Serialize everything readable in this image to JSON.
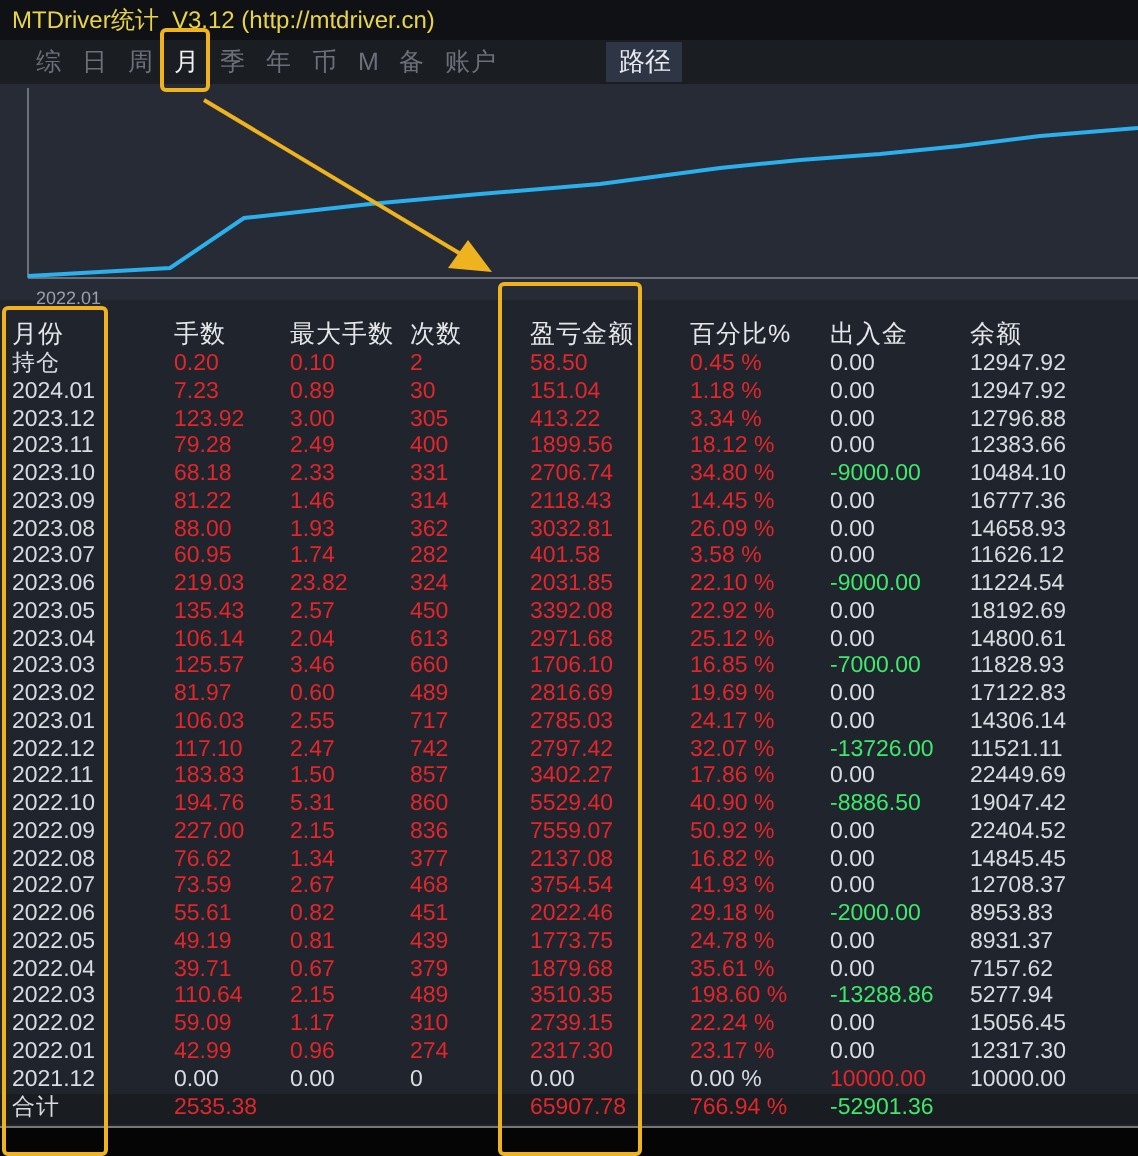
{
  "window": {
    "title": "MTDriver统计  V3.12 (http://mtdriver.cn)"
  },
  "tabs": [
    {
      "label": "综",
      "selected": false
    },
    {
      "label": "日",
      "selected": false
    },
    {
      "label": "周",
      "selected": false
    },
    {
      "label": "月",
      "selected": true
    },
    {
      "label": "季",
      "selected": false
    },
    {
      "label": "年",
      "selected": false
    },
    {
      "label": "币",
      "selected": false
    },
    {
      "label": "M",
      "selected": false
    },
    {
      "label": "备",
      "selected": false
    },
    {
      "label": "账户",
      "selected": false
    }
  ],
  "path_button": "路径",
  "chart": {
    "x_label": "2022.01"
  },
  "table": {
    "columns": [
      "月份",
      "手数",
      "最大手数",
      "次数",
      "盈亏金额",
      "百分比%",
      "出入金",
      "余额"
    ],
    "rows": [
      {
        "label": "持仓",
        "kind": "profit",
        "lots": "0.20",
        "max_lots": "0.10",
        "trades": "2",
        "pnl": "58.50",
        "pct": "0.45 %",
        "deposit": {
          "text": "0.00",
          "color": "#d8dbe0"
        },
        "balance": "12947.92"
      },
      {
        "label": "2024.01",
        "kind": "profit",
        "lots": "7.23",
        "max_lots": "0.89",
        "trades": "30",
        "pnl": "151.04",
        "pct": "1.18 %",
        "deposit": {
          "text": "0.00",
          "color": "#d8dbe0"
        },
        "balance": "12947.92"
      },
      {
        "label": "2023.12",
        "kind": "profit",
        "lots": "123.92",
        "max_lots": "3.00",
        "trades": "305",
        "pnl": "413.22",
        "pct": "3.34 %",
        "deposit": {
          "text": "0.00",
          "color": "#d8dbe0"
        },
        "balance": "12796.88"
      },
      {
        "label": "2023.11",
        "kind": "profit",
        "lots": "79.28",
        "max_lots": "2.49",
        "trades": "400",
        "pnl": "1899.56",
        "pct": "18.12 %",
        "deposit": {
          "text": "0.00",
          "color": "#d8dbe0"
        },
        "balance": "12383.66"
      },
      {
        "label": "2023.10",
        "kind": "profit",
        "lots": "68.18",
        "max_lots": "2.33",
        "trades": "331",
        "pnl": "2706.74",
        "pct": "34.80 %",
        "deposit": {
          "text": "-9000.00",
          "color": "#3ee86a"
        },
        "balance": "10484.10"
      },
      {
        "label": "2023.09",
        "kind": "profit",
        "lots": "81.22",
        "max_lots": "1.46",
        "trades": "314",
        "pnl": "2118.43",
        "pct": "14.45 %",
        "deposit": {
          "text": "0.00",
          "color": "#d8dbe0"
        },
        "balance": "16777.36"
      },
      {
        "label": "2023.08",
        "kind": "profit",
        "lots": "88.00",
        "max_lots": "1.93",
        "trades": "362",
        "pnl": "3032.81",
        "pct": "26.09 %",
        "deposit": {
          "text": "0.00",
          "color": "#d8dbe0"
        },
        "balance": "14658.93"
      },
      {
        "label": "2023.07",
        "kind": "profit",
        "lots": "60.95",
        "max_lots": "1.74",
        "trades": "282",
        "pnl": "401.58",
        "pct": "3.58 %",
        "deposit": {
          "text": "0.00",
          "color": "#d8dbe0"
        },
        "balance": "11626.12"
      },
      {
        "label": "2023.06",
        "kind": "profit",
        "lots": "219.03",
        "max_lots": "23.82",
        "trades": "324",
        "pnl": "2031.85",
        "pct": "22.10 %",
        "deposit": {
          "text": "-9000.00",
          "color": "#3ee86a"
        },
        "balance": "11224.54"
      },
      {
        "label": "2023.05",
        "kind": "profit",
        "lots": "135.43",
        "max_lots": "2.57",
        "trades": "450",
        "pnl": "3392.08",
        "pct": "22.92 %",
        "deposit": {
          "text": "0.00",
          "color": "#d8dbe0"
        },
        "balance": "18192.69"
      },
      {
        "label": "2023.04",
        "kind": "profit",
        "lots": "106.14",
        "max_lots": "2.04",
        "trades": "613",
        "pnl": "2971.68",
        "pct": "25.12 %",
        "deposit": {
          "text": "0.00",
          "color": "#d8dbe0"
        },
        "balance": "14800.61"
      },
      {
        "label": "2023.03",
        "kind": "profit",
        "lots": "125.57",
        "max_lots": "3.46",
        "trades": "660",
        "pnl": "1706.10",
        "pct": "16.85 %",
        "deposit": {
          "text": "-7000.00",
          "color": "#3ee86a"
        },
        "balance": "11828.93"
      },
      {
        "label": "2023.02",
        "kind": "profit",
        "lots": "81.97",
        "max_lots": "0.60",
        "trades": "489",
        "pnl": "2816.69",
        "pct": "19.69 %",
        "deposit": {
          "text": "0.00",
          "color": "#d8dbe0"
        },
        "balance": "17122.83"
      },
      {
        "label": "2023.01",
        "kind": "profit",
        "lots": "106.03",
        "max_lots": "2.55",
        "trades": "717",
        "pnl": "2785.03",
        "pct": "24.17 %",
        "deposit": {
          "text": "0.00",
          "color": "#d8dbe0"
        },
        "balance": "14306.14"
      },
      {
        "label": "2022.12",
        "kind": "profit",
        "lots": "117.10",
        "max_lots": "2.47",
        "trades": "742",
        "pnl": "2797.42",
        "pct": "32.07 %",
        "deposit": {
          "text": "-13726.00",
          "color": "#3ee86a"
        },
        "balance": "11521.11"
      },
      {
        "label": "2022.11",
        "kind": "profit",
        "lots": "183.83",
        "max_lots": "1.50",
        "trades": "857",
        "pnl": "3402.27",
        "pct": "17.86 %",
        "deposit": {
          "text": "0.00",
          "color": "#d8dbe0"
        },
        "balance": "22449.69"
      },
      {
        "label": "2022.10",
        "kind": "profit",
        "lots": "194.76",
        "max_lots": "5.31",
        "trades": "860",
        "pnl": "5529.40",
        "pct": "40.90 %",
        "deposit": {
          "text": "-8886.50",
          "color": "#3ee86a"
        },
        "balance": "19047.42"
      },
      {
        "label": "2022.09",
        "kind": "profit",
        "lots": "227.00",
        "max_lots": "2.15",
        "trades": "836",
        "pnl": "7559.07",
        "pct": "50.92 %",
        "deposit": {
          "text": "0.00",
          "color": "#d8dbe0"
        },
        "balance": "22404.52"
      },
      {
        "label": "2022.08",
        "kind": "profit",
        "lots": "76.62",
        "max_lots": "1.34",
        "trades": "377",
        "pnl": "2137.08",
        "pct": "16.82 %",
        "deposit": {
          "text": "0.00",
          "color": "#d8dbe0"
        },
        "balance": "14845.45"
      },
      {
        "label": "2022.07",
        "kind": "profit",
        "lots": "73.59",
        "max_lots": "2.67",
        "trades": "468",
        "pnl": "3754.54",
        "pct": "41.93 %",
        "deposit": {
          "text": "0.00",
          "color": "#d8dbe0"
        },
        "balance": "12708.37"
      },
      {
        "label": "2022.06",
        "kind": "profit",
        "lots": "55.61",
        "max_lots": "0.82",
        "trades": "451",
        "pnl": "2022.46",
        "pct": "29.18 %",
        "deposit": {
          "text": "-2000.00",
          "color": "#3ee86a"
        },
        "balance": "8953.83"
      },
      {
        "label": "2022.05",
        "kind": "profit",
        "lots": "49.19",
        "max_lots": "0.81",
        "trades": "439",
        "pnl": "1773.75",
        "pct": "24.78 %",
        "deposit": {
          "text": "0.00",
          "color": "#d8dbe0"
        },
        "balance": "8931.37"
      },
      {
        "label": "2022.04",
        "kind": "profit",
        "lots": "39.71",
        "max_lots": "0.67",
        "trades": "379",
        "pnl": "1879.68",
        "pct": "35.61 %",
        "deposit": {
          "text": "0.00",
          "color": "#d8dbe0"
        },
        "balance": "7157.62"
      },
      {
        "label": "2022.03",
        "kind": "profit",
        "lots": "110.64",
        "max_lots": "2.15",
        "trades": "489",
        "pnl": "3510.35",
        "pct": "198.60 %",
        "deposit": {
          "text": "-13288.86",
          "color": "#3ee86a"
        },
        "balance": "5277.94"
      },
      {
        "label": "2022.02",
        "kind": "profit",
        "lots": "59.09",
        "max_lots": "1.17",
        "trades": "310",
        "pnl": "2739.15",
        "pct": "22.24 %",
        "deposit": {
          "text": "0.00",
          "color": "#d8dbe0"
        },
        "balance": "15056.45"
      },
      {
        "label": "2022.01",
        "kind": "profit",
        "lots": "42.99",
        "max_lots": "0.96",
        "trades": "274",
        "pnl": "2317.30",
        "pct": "23.17 %",
        "deposit": {
          "text": "0.00",
          "color": "#d8dbe0"
        },
        "balance": "12317.30"
      },
      {
        "label": "2021.12",
        "kind": "empty",
        "lots": "0.00",
        "max_lots": "0.00",
        "trades": "0",
        "pnl": "0.00",
        "pct": "0.00 %",
        "deposit": {
          "text": "10000.00",
          "color": "#e2262a"
        },
        "balance": "10000.00"
      }
    ],
    "total": {
      "label": "合计",
      "kind": "total",
      "lots": "2535.38",
      "pnl": "65907.78",
      "pct": "766.94 %",
      "deposit": {
        "text": "-52901.36",
        "color": "#3ee86a"
      }
    }
  }
}
